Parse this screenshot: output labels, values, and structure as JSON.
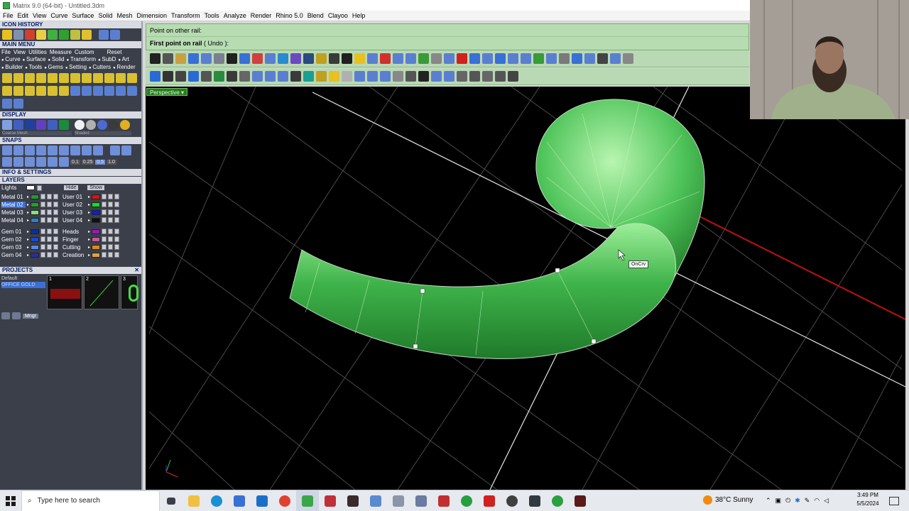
{
  "window": {
    "title": "Matrix 9.0 (64-bit) - Untitled.3dm"
  },
  "menu": [
    "File",
    "Edit",
    "View",
    "Curve",
    "Surface",
    "Solid",
    "Mesh",
    "Dimension",
    "Transform",
    "Tools",
    "Analyze",
    "Render",
    "Rhino 5.0",
    "Blend",
    "Clayoo",
    "Help"
  ],
  "left": {
    "icon_history": "ICON HISTORY",
    "main_menu": "MAIN MENU",
    "mm_tabs": [
      "File",
      "View",
      "Utilities",
      "Measure",
      "Custom",
      "Reset"
    ],
    "mm_row1": [
      "Curve",
      "Surface",
      "Solid",
      "Transform",
      "SubD",
      "Art"
    ],
    "mm_row2": [
      "Builder",
      "Tools",
      "Gems",
      "Setting",
      "Cutters",
      "Render"
    ],
    "display": "DISPLAY",
    "display_modes": [
      "Coarse Mesh",
      "Shaded"
    ],
    "snaps": "SNAPS",
    "snap_values": [
      "0.1",
      "0.25",
      "0.5",
      "1.0"
    ],
    "info": "INFO & SETTINGS",
    "layers_title": "LAYERS",
    "lights": "Lights",
    "hide": "Hide",
    "show": "Show",
    "layers_a": [
      {
        "name": "Metal 01",
        "color": "#1f9b2f"
      },
      {
        "name": "Metal 02",
        "color": "#1fa02a"
      },
      {
        "name": "Metal 03",
        "color": "#86e07c"
      },
      {
        "name": "Metal 04",
        "color": "#2f7bd8"
      },
      {
        "name": "Gem 01",
        "color": "#0d2e9c"
      },
      {
        "name": "Gem 02",
        "color": "#1a4bd6"
      },
      {
        "name": "Gem 03",
        "color": "#5d86e8"
      },
      {
        "name": "Gem 04",
        "color": "#2a2f9a"
      }
    ],
    "layers_b": [
      {
        "name": "User 01",
        "color": "#e01010"
      },
      {
        "name": "User 02",
        "color": "#10e020"
      },
      {
        "name": "User 03",
        "color": "#0a1fd8"
      },
      {
        "name": "User 04",
        "color": "#101010"
      },
      {
        "name": "Heads",
        "color": "#9a1ab8"
      },
      {
        "name": "Finger",
        "color": "#c85a9a"
      },
      {
        "name": "Cutting",
        "color": "#e08a10"
      },
      {
        "name": "Creation",
        "color": "#e0a040"
      }
    ],
    "projects": "PROJECTS",
    "project_default": "Default",
    "project_selected": "OFFICE GOLD",
    "project_thumbs": [
      "1",
      "2",
      "3"
    ],
    "mngr": "Mngr"
  },
  "prompt": {
    "line1": "Point on other rail:",
    "line2_main": "First point on rail",
    "line2_undo": "( Undo ):"
  },
  "viewport": {
    "label": "Perspective",
    "osnap_tooltip": "OnCrv"
  },
  "taskbar": {
    "search_placeholder": "Type here to search",
    "weather": "38°C  Sunny",
    "time": "3:49 PM",
    "date": "5/5/2024"
  }
}
